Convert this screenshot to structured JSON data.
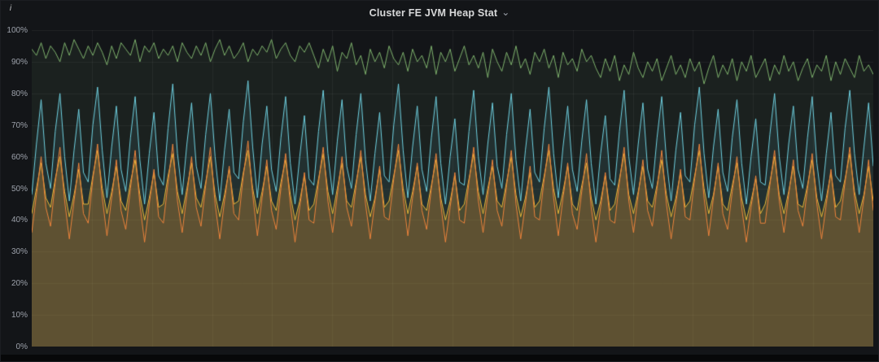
{
  "panel": {
    "title": "Cluster FE JVM Heap Stat"
  },
  "icons": {
    "info": "i",
    "chevron_down": "⌄"
  },
  "colors": {
    "page_bg": "#0b0c0e",
    "panel_bg": "#131518",
    "grid": "rgba(255,255,255,0.055)",
    "axis_text": "#9da2ab",
    "title_text": "#d8d9da"
  },
  "chart_data": {
    "type": "line",
    "title": "Cluster FE JVM Heap Stat",
    "ylim": [
      0,
      100
    ],
    "y_tick_labels": [
      "100%",
      "90%",
      "80%",
      "70%",
      "60%",
      "50%",
      "40%",
      "30%",
      "20%",
      "10%",
      "0%"
    ],
    "grid": true,
    "legend_position": "none-visible",
    "vertical_grid_divisions": 14,
    "series": [
      {
        "name": "green-series",
        "color": "#7EB26D",
        "fill": "rgba(126,178,109,0.08)",
        "approx_range": "83-97%",
        "values": [
          94,
          92,
          96,
          91,
          95,
          93,
          90,
          96,
          92,
          97,
          94,
          91,
          95,
          92,
          96,
          93,
          89,
          95,
          91,
          96,
          94,
          92,
          97,
          90,
          95,
          93,
          96,
          91,
          94,
          92,
          95,
          90,
          96,
          93,
          91,
          95,
          92,
          96,
          90,
          94,
          97,
          92,
          95,
          91,
          93,
          96,
          90,
          94,
          92,
          95,
          93,
          97,
          91,
          94,
          96,
          92,
          90,
          95,
          93,
          96,
          92,
          88,
          94,
          90,
          95,
          87,
          93,
          91,
          96,
          89,
          92,
          86,
          94,
          90,
          93,
          88,
          95,
          91,
          89,
          93,
          87,
          94,
          90,
          92,
          88,
          95,
          86,
          93,
          90,
          94,
          87,
          91,
          95,
          89,
          92,
          88,
          93,
          85,
          94,
          90,
          87,
          93,
          89,
          95,
          88,
          91,
          86,
          93,
          90,
          94,
          88,
          92,
          85,
          93,
          89,
          91,
          87,
          94,
          90,
          92,
          88,
          85,
          91,
          87,
          92,
          84,
          89,
          86,
          93,
          88,
          85,
          90,
          87,
          91,
          84,
          88,
          92,
          86,
          89,
          85,
          91,
          87,
          90,
          83,
          88,
          92,
          85,
          89,
          86,
          91,
          84,
          90,
          87,
          92,
          85,
          88,
          91,
          84,
          89,
          86,
          92,
          87,
          90,
          84,
          88,
          91,
          85,
          89,
          87,
          92,
          84,
          90,
          86,
          91,
          88,
          85,
          92,
          87,
          89,
          86
        ]
      },
      {
        "name": "cyan-series",
        "color": "#6ED0E0",
        "fill": "rgba(110,208,224,0.09)",
        "approx_range": "45-84%",
        "values": [
          48,
          64,
          78,
          58,
          50,
          68,
          80,
          60,
          46,
          62,
          75,
          55,
          52,
          70,
          82,
          62,
          47,
          63,
          76,
          56,
          49,
          66,
          79,
          59,
          45,
          61,
          74,
          54,
          51,
          69,
          83,
          61,
          48,
          64,
          77,
          57,
          50,
          67,
          80,
          60,
          46,
          62,
          75,
          55,
          53,
          71,
          84,
          63,
          47,
          64,
          76,
          56,
          49,
          66,
          79,
          58,
          45,
          60,
          73,
          53,
          51,
          68,
          81,
          61,
          48,
          65,
          78,
          57,
          50,
          67,
          80,
          59,
          46,
          61,
          74,
          54,
          52,
          70,
          83,
          62,
          47,
          63,
          76,
          56,
          49,
          66,
          79,
          58,
          45,
          60,
          72,
          52,
          51,
          68,
          81,
          60,
          48,
          64,
          77,
          57,
          50,
          67,
          80,
          59,
          46,
          62,
          75,
          55,
          52,
          69,
          82,
          61,
          47,
          63,
          76,
          56,
          49,
          65,
          78,
          58,
          45,
          61,
          73,
          53,
          51,
          68,
          81,
          60,
          48,
          64,
          77,
          56,
          50,
          66,
          79,
          59,
          46,
          62,
          74,
          54,
          52,
          70,
          82,
          61,
          47,
          63,
          75,
          55,
          49,
          66,
          78,
          58,
          45,
          60,
          72,
          52,
          51,
          67,
          80,
          60,
          48,
          64,
          76,
          56,
          50,
          66,
          79,
          58,
          46,
          61,
          74,
          54,
          52,
          69,
          81,
          61,
          48,
          63,
          77,
          57
        ]
      },
      {
        "name": "yellow-series",
        "color": "#EAB839",
        "fill": "rgba(234,184,57,0.20)",
        "approx_range": "40-62%",
        "values": [
          42,
          50,
          58,
          47,
          44,
          53,
          60,
          49,
          41,
          48,
          56,
          45,
          45,
          54,
          62,
          50,
          42,
          49,
          57,
          46,
          43,
          52,
          59,
          48,
          40,
          47,
          55,
          44,
          45,
          54,
          61,
          49,
          42,
          50,
          58,
          47,
          44,
          52,
          60,
          48,
          41,
          48,
          56,
          45,
          46,
          55,
          62,
          50,
          42,
          49,
          57,
          46,
          43,
          52,
          59,
          48,
          40,
          46,
          54,
          43,
          45,
          53,
          61,
          49,
          42,
          50,
          58,
          46,
          44,
          52,
          60,
          48,
          41,
          47,
          56,
          44,
          46,
          54,
          62,
          50,
          42,
          49,
          57,
          45,
          43,
          51,
          59,
          47,
          40,
          46,
          54,
          43,
          45,
          53,
          61,
          49,
          42,
          50,
          57,
          46,
          44,
          52,
          60,
          48,
          41,
          47,
          55,
          44,
          46,
          54,
          62,
          50,
          42,
          49,
          57,
          45,
          43,
          51,
          58,
          47,
          40,
          46,
          54,
          43,
          45,
          53,
          61,
          48,
          42,
          49,
          57,
          46,
          44,
          51,
          59,
          48,
          41,
          47,
          55,
          44,
          46,
          54,
          62,
          50,
          42,
          48,
          57,
          45,
          43,
          51,
          58,
          47,
          40,
          46,
          53,
          42,
          45,
          52,
          60,
          48,
          42,
          49,
          57,
          45,
          44,
          51,
          59,
          47,
          41,
          47,
          55,
          44,
          46,
          53,
          61,
          49,
          42,
          48,
          57,
          46
        ]
      },
      {
        "name": "orange-series",
        "color": "#EF843C",
        "fill": "rgba(239,132,60,0.12)",
        "approx_range": "33-65%",
        "values": [
          36,
          48,
          60,
          44,
          38,
          52,
          63,
          46,
          34,
          46,
          58,
          42,
          39,
          53,
          64,
          47,
          35,
          47,
          59,
          43,
          37,
          50,
          62,
          45,
          33,
          45,
          56,
          41,
          39,
          52,
          64,
          46,
          36,
          48,
          60,
          44,
          38,
          51,
          63,
          45,
          34,
          46,
          57,
          42,
          40,
          54,
          65,
          48,
          35,
          47,
          59,
          43,
          37,
          50,
          61,
          45,
          33,
          44,
          55,
          40,
          39,
          52,
          63,
          46,
          36,
          48,
          60,
          44,
          38,
          51,
          62,
          45,
          34,
          46,
          57,
          41,
          40,
          53,
          64,
          47,
          35,
          47,
          58,
          43,
          37,
          50,
          61,
          45,
          33,
          44,
          55,
          40,
          39,
          52,
          63,
          46,
          36,
          48,
          59,
          43,
          38,
          51,
          62,
          45,
          34,
          45,
          57,
          41,
          40,
          53,
          64,
          47,
          35,
          47,
          58,
          42,
          37,
          49,
          61,
          44,
          33,
          44,
          55,
          40,
          39,
          52,
          63,
          46,
          36,
          48,
          59,
          43,
          38,
          50,
          62,
          45,
          34,
          45,
          56,
          41,
          40,
          53,
          64,
          47,
          35,
          47,
          58,
          42,
          37,
          49,
          60,
          44,
          33,
          44,
          54,
          39,
          39,
          51,
          62,
          46,
          36,
          48,
          59,
          43,
          38,
          50,
          61,
          45,
          34,
          45,
          56,
          41,
          40,
          52,
          63,
          47,
          36,
          47,
          59,
          43
        ]
      }
    ]
  }
}
